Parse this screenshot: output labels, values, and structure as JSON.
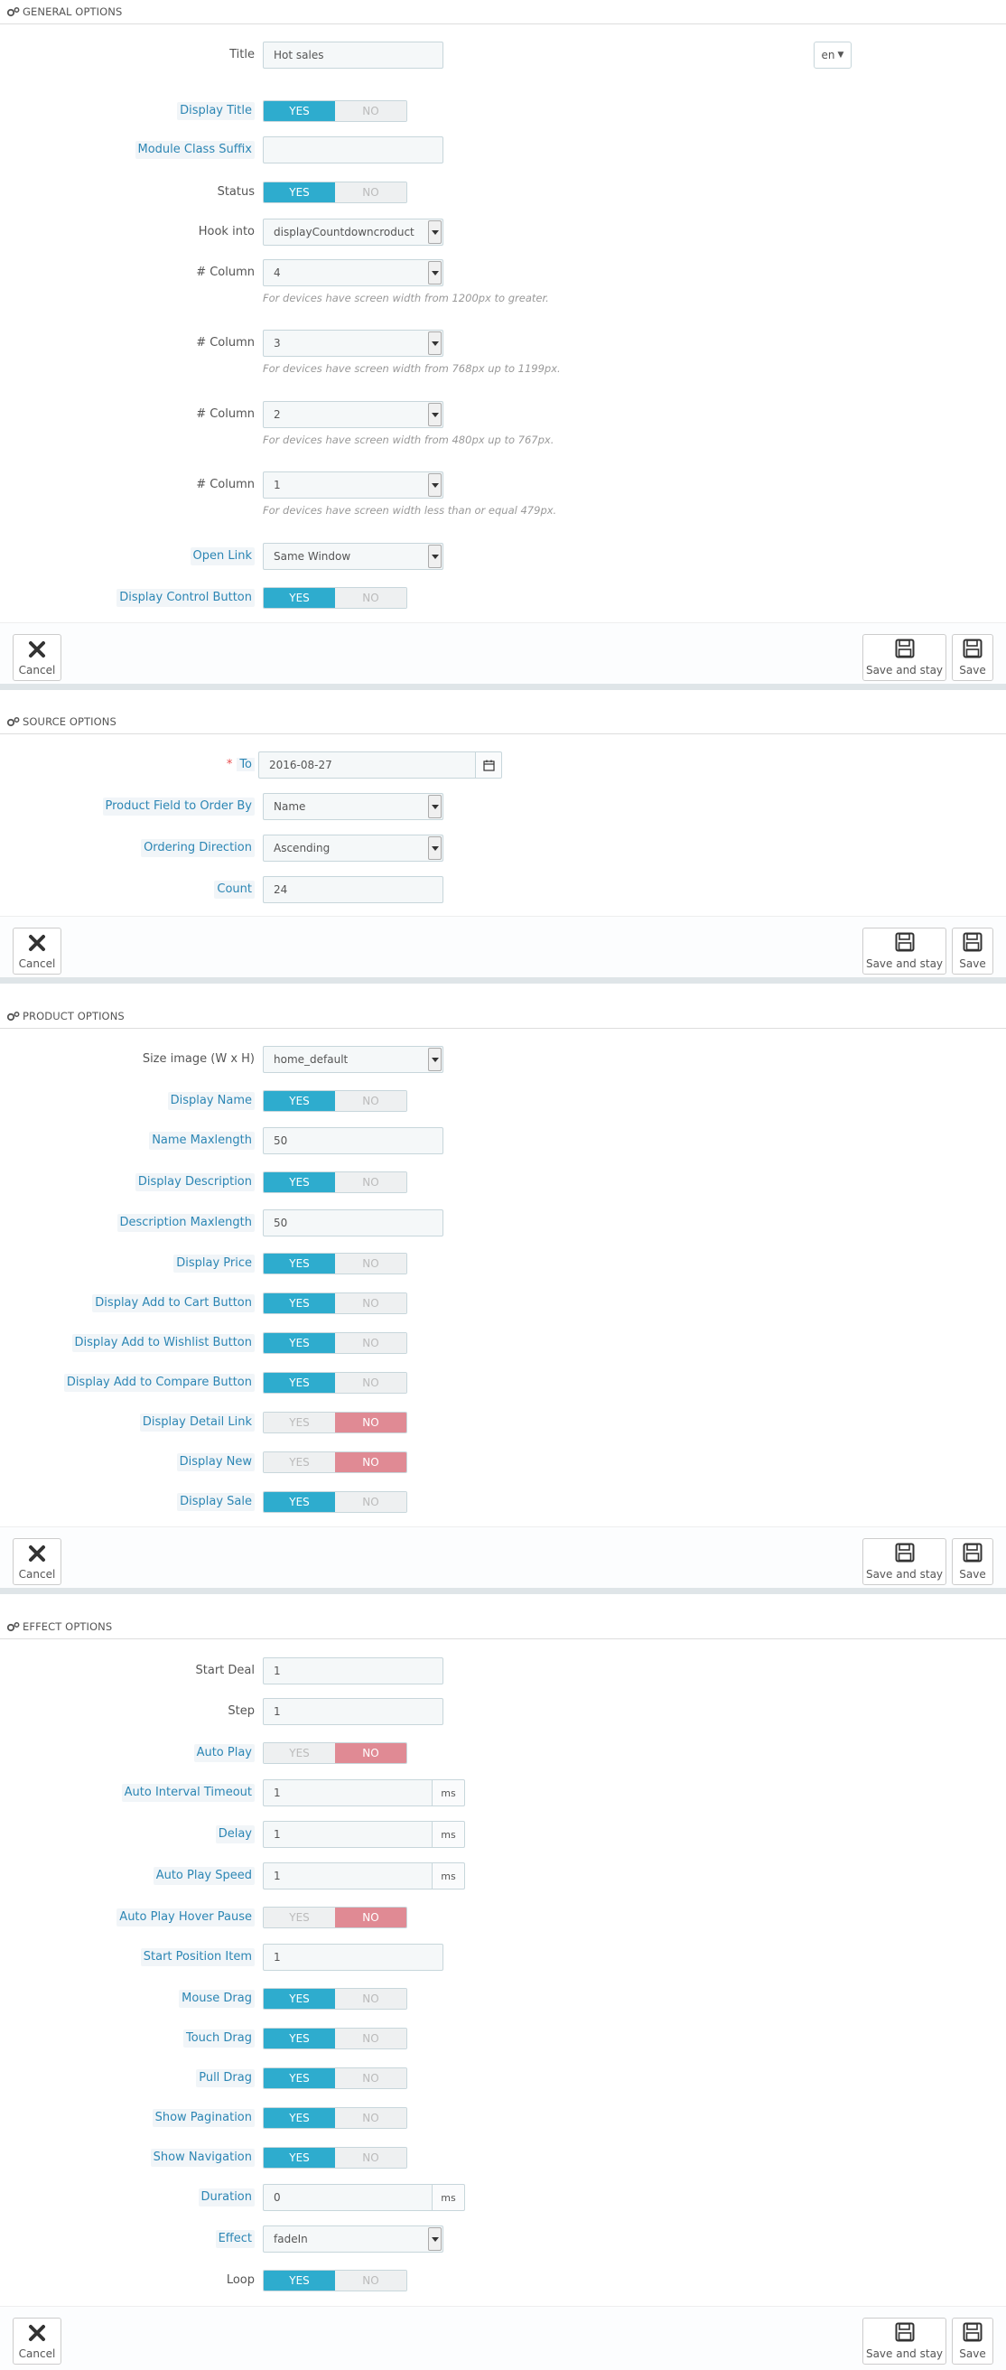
{
  "general": {
    "header": "GENERAL OPTIONS",
    "title_label": "Title",
    "title_value": "Hot sales",
    "lang": "en",
    "display_title_label": "Display Title",
    "suffix_label": "Module Class Suffix",
    "suffix_value": "",
    "status_label": "Status",
    "hook_label": "Hook into",
    "hook_value": "displayCountdowncroduct",
    "col_label": "# Column",
    "col1_value": "4",
    "col1_help": "For devices have screen width from 1200px to greater.",
    "col2_value": "3",
    "col2_help": "For devices have screen width from 768px up to 1199px.",
    "col3_value": "2",
    "col3_help": "For devices have screen width from 480px up to 767px.",
    "col4_value": "1",
    "col4_help": "For devices have screen width less than or equal 479px.",
    "open_link_label": "Open Link",
    "open_link_value": "Same Window",
    "control_btn_label": "Display Control Button"
  },
  "source": {
    "header": "SOURCE OPTIONS",
    "required_mark": "*",
    "to_label": "To",
    "to_value": "2016-08-27",
    "order_by_label": "Product Field to Order By",
    "order_by_value": "Name",
    "direction_label": "Ordering Direction",
    "direction_value": "Ascending",
    "count_label": "Count",
    "count_value": "24"
  },
  "product": {
    "header": "PRODUCT OPTIONS",
    "size_label": "Size image (W x H)",
    "size_value": "home_default",
    "display_name_label": "Display Name",
    "name_max_label": "Name Maxlength",
    "name_max_value": "50",
    "display_desc_label": "Display Description",
    "desc_max_label": "Description Maxlength",
    "desc_max_value": "50",
    "display_price_label": "Display Price",
    "add_cart_label": "Display Add to Cart Button",
    "add_wishlist_label": "Display Add to Wishlist Button",
    "add_compare_label": "Display Add to Compare Button",
    "detail_link_label": "Display Detail Link",
    "display_new_label": "Display New",
    "display_sale_label": "Display Sale"
  },
  "effect": {
    "header": "EFFECT OPTIONS",
    "start_deal_label": "Start Deal",
    "start_deal_value": "1",
    "step_label": "Step",
    "step_value": "1",
    "autoplay_label": "Auto Play",
    "interval_label": "Auto Interval Timeout",
    "interval_value": "1",
    "delay_label": "Delay",
    "delay_value": "1",
    "speed_label": "Auto Play Speed",
    "speed_value": "1",
    "hover_pause_label": "Auto Play Hover Pause",
    "start_pos_label": "Start Position Item",
    "start_pos_value": "1",
    "mouse_drag_label": "Mouse Drag",
    "touch_drag_label": "Touch Drag",
    "pull_drag_label": "Pull Drag",
    "pagination_label": "Show Pagination",
    "navigation_label": "Show Navigation",
    "duration_label": "Duration",
    "duration_value": "0",
    "effect_label": "Effect",
    "effect_value": "fadeIn",
    "loop_label": "Loop",
    "unit_ms": "ms"
  },
  "switch": {
    "yes": "YES",
    "no": "NO"
  },
  "footer": {
    "cancel": "Cancel",
    "save_stay": "Save and stay",
    "save": "Save"
  },
  "colors": {
    "accent": "#2eacce",
    "no": "#e08a94",
    "label_link": "#2c86b4"
  }
}
